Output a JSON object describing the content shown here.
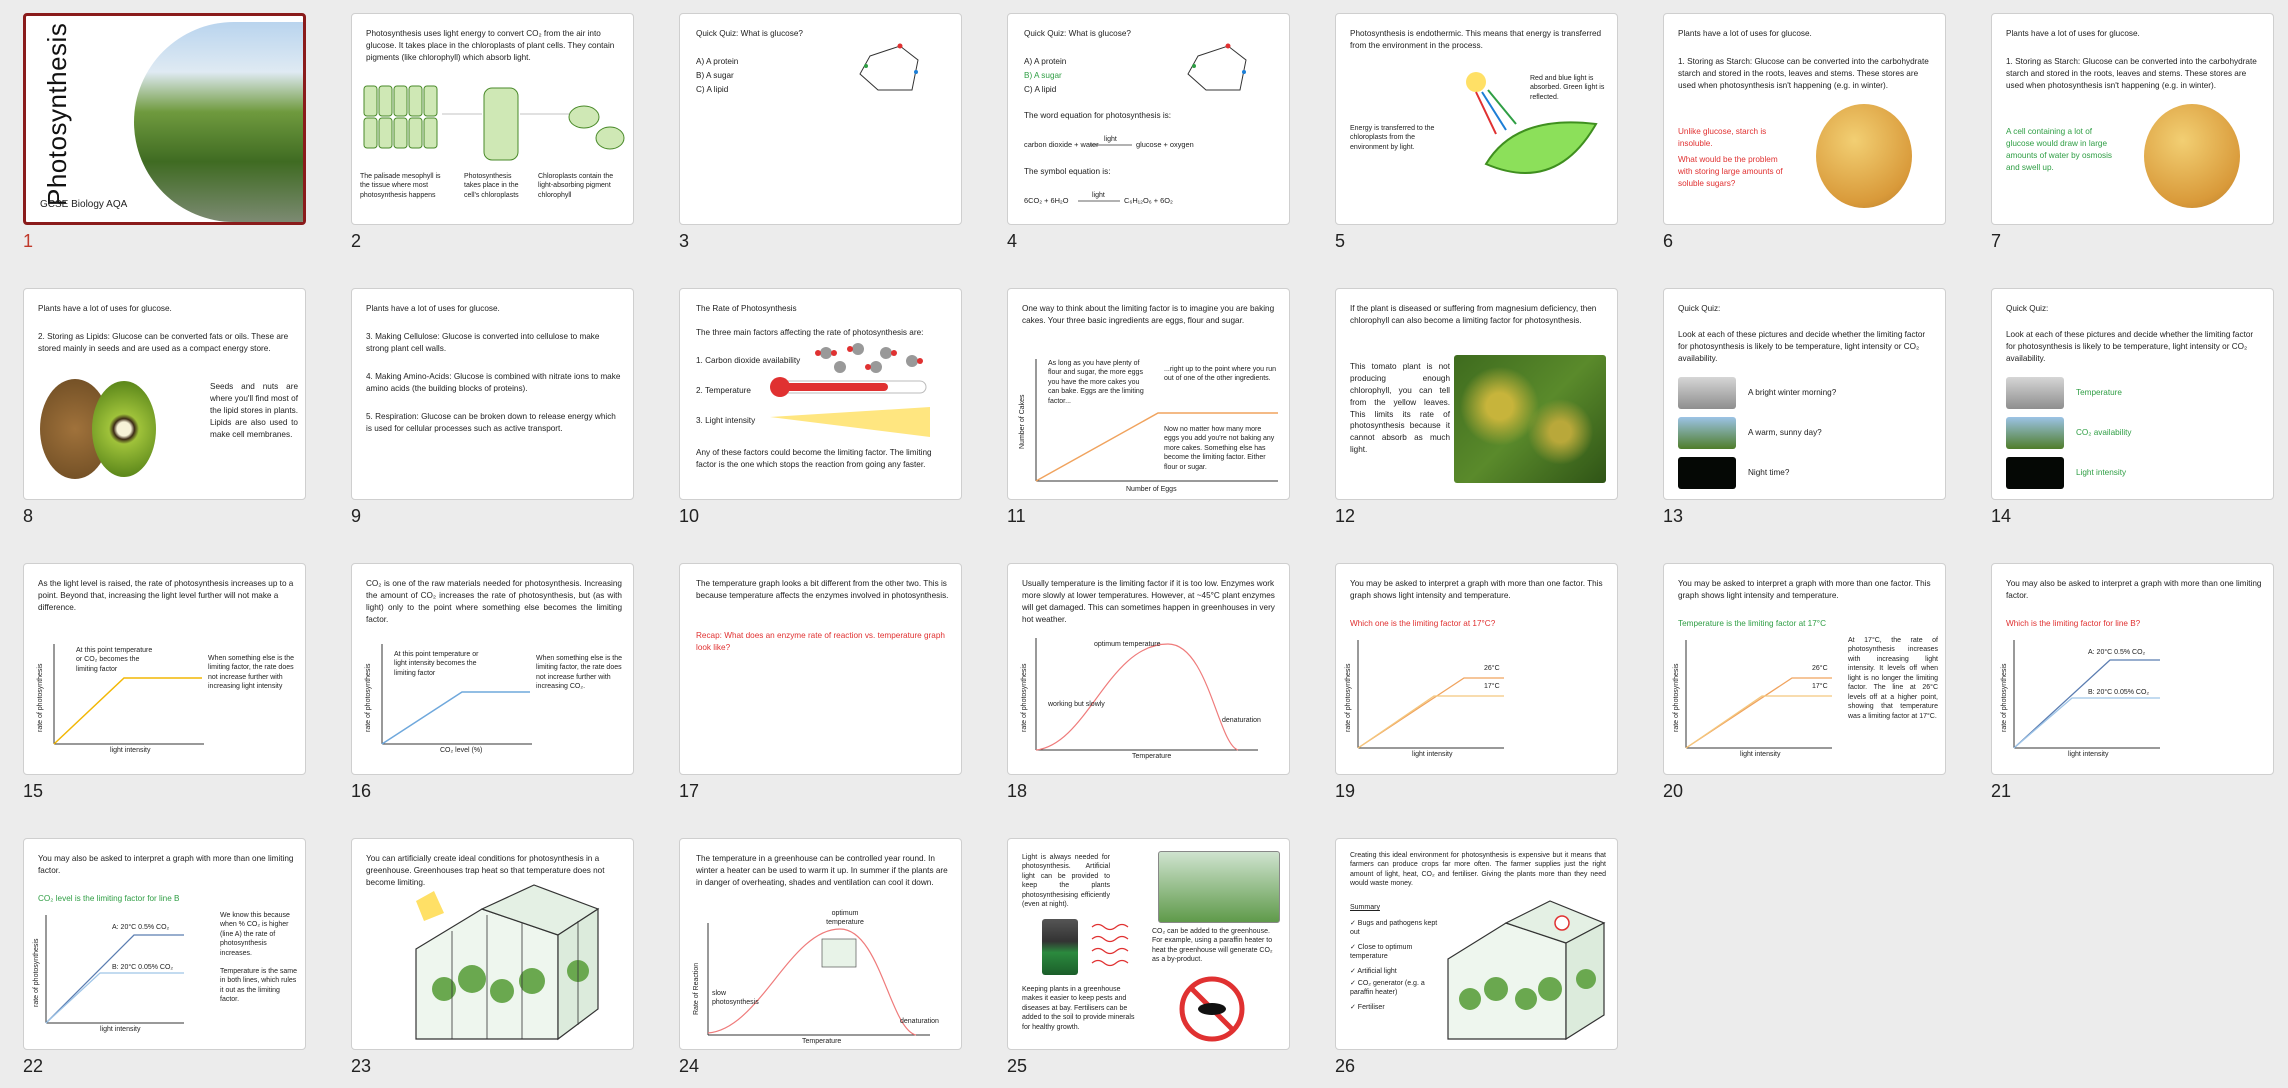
{
  "app": {
    "view": "slide-sorter"
  },
  "slides": [
    {
      "n": "1",
      "title": "Photosynthesis",
      "subtitle": "GCSE Biology AQA"
    },
    {
      "n": "2",
      "body": "Photosynthesis uses light energy to convert CO₂ from the air into glucose. It takes place in the chloroplasts of plant cells. They contain pigments (like chlorophyll) which absorb light.",
      "c1": "The palisade mesophyll is the tissue where most photosynthesis happens",
      "c2": "Photosynthesis takes place in the cell's chloroplasts",
      "c3": "Chloroplasts contain the light-absorbing pigment chlorophyll"
    },
    {
      "n": "3",
      "q": "Quick Quiz: What is glucose?",
      "a": "A) A protein",
      "b": "B) A sugar",
      "c": "C) A lipid"
    },
    {
      "n": "4",
      "q": "Quick Quiz: What is glucose?",
      "a": "A) A protein",
      "b": "B) A sugar",
      "c": "C) A lipid",
      "l1": "The word equation for photosynthesis is:",
      "eq1a": "carbon dioxide + water",
      "eq1b": "glucose + oxygen",
      "light": "light",
      "l2": "The symbol equation is:",
      "eq2a": "6CO₂ + 6H₂O",
      "eq2b": "C₆H₁₂O₆ + 6O₂"
    },
    {
      "n": "5",
      "body": "Photosynthesis is endothermic. This means that energy is transferred from the environment in the process.",
      "c1": "Red and blue light is absorbed. Green light is reflected.",
      "c2": "Energy is transferred to the chloroplasts from the environment by light."
    },
    {
      "n": "6",
      "h": "Plants have a lot of uses for glucose.",
      "p": "1. Storing as Starch: Glucose can be converted into the carbohydrate starch and stored in the roots, leaves and stems. These stores are used when photosynthesis isn't happening (e.g. in winter).",
      "r1": "Unlike glucose, starch is insoluble.",
      "r2": "What would be the problem with storing large amounts of soluble sugars?"
    },
    {
      "n": "7",
      "h": "Plants have a lot of uses for glucose.",
      "p": "1. Storing as Starch: Glucose can be converted into the carbohydrate starch and stored in the roots, leaves and stems. These stores are used when photosynthesis isn't happening (e.g. in winter).",
      "g1": "A cell containing a lot of glucose would draw in large amounts of water by osmosis and swell up."
    },
    {
      "n": "8",
      "h": "Plants have a lot of uses for glucose.",
      "p": "2. Storing as Lipids: Glucose can be converted fats or oils. These are stored mainly in seeds and are used as a compact energy store.",
      "c1": "Seeds and nuts are where you'll find most of the lipid stores in plants. Lipids are also used to make cell membranes."
    },
    {
      "n": "9",
      "h": "Plants have a lot of uses for glucose.",
      "p3": "3. Making Cellulose: Glucose is converted into cellulose to make strong plant cell walls.",
      "p4": "4. Making Amino-Acids: Glucose is combined with nitrate ions to make amino acids (the building blocks of proteins).",
      "p5": "5. Respiration: Glucose can be broken down to release energy which is used for cellular processes such as active transport."
    },
    {
      "n": "10",
      "h": "The Rate of Photosynthesis",
      "p": "The three main factors affecting the rate of photosynthesis are:",
      "f1": "1. Carbon dioxide availability",
      "f2": "2. Temperature",
      "f3": "3. Light intensity",
      "foot": "Any of these factors could become the limiting factor. The limiting factor is the one which stops the reaction from going any faster."
    },
    {
      "n": "11",
      "p": "One way to think about the limiting factor is to imagine you are baking cakes. Your three basic ingredients are eggs, flour and sugar.",
      "a1": "As long as you have plenty of flour and sugar, the more eggs you have the more cakes you can bake. Eggs are the limiting factor...",
      "a2": "...right up to the point where you run out of one of the other ingredients.",
      "a3": "Now no matter how many more eggs you add you're not baking any more cakes. Something else has become the limiting factor. Either flour or sugar.",
      "ylab": "Number of Cakes",
      "xlab": "Number of Eggs"
    },
    {
      "n": "12",
      "p": "If the plant is diseased or suffering from magnesium deficiency, then chlorophyll can also become a limiting factor for photosynthesis.",
      "c1": "This tomato plant is not producing enough chlorophyll, you can tell from the yellow leaves. This limits its rate of photosynthesis because it cannot absorb as much light."
    },
    {
      "n": "13",
      "h": "Quick Quiz:",
      "p": "Look at each of these pictures and decide whether the limiting factor for photosynthesis is likely to be temperature, light intensity or CO₂ availability.",
      "q1": "A bright winter morning?",
      "q2": "A warm, sunny day?",
      "q3": "Night time?"
    },
    {
      "n": "14",
      "h": "Quick Quiz:",
      "p": "Look at each of these pictures and decide whether the limiting factor for photosynthesis is likely to be temperature, light intensity or CO₂ availability.",
      "q1": "Temperature",
      "q2": "CO₂ availability",
      "q3": "Light intensity"
    },
    {
      "n": "15",
      "p": "As the light level is raised, the rate of photosynthesis increases up to a point. Beyond that, increasing the light level further will not make a difference.",
      "a1": "At this point temperature or CO₂ becomes the limiting factor",
      "a2": "When something else is the limiting factor, the rate does not increase further with increasing light intensity",
      "ylab": "rate of photosynthesis",
      "xlab": "light intensity"
    },
    {
      "n": "16",
      "p": "CO₂ is one of the raw materials needed for photosynthesis. Increasing the amount of CO₂ increases the rate of photosynthesis, but (as with light) only to the point where something else becomes the limiting factor.",
      "a1": "At this point temperature or light intensity becomes the limiting factor",
      "a2": "When something else is the limiting factor, the rate does not increase further with increasing CO₂.",
      "ylab": "rate of photosynthesis",
      "xlab": "CO₂ level (%)"
    },
    {
      "n": "17",
      "p": "The temperature graph looks a bit different from the other two. This is because temperature affects the enzymes involved in photosynthesis.",
      "r": "Recap: What does an enzyme rate of reaction vs. temperature graph look like?"
    },
    {
      "n": "18",
      "p": "Usually temperature is the limiting factor if it is too low. Enzymes work more slowly at lower temperatures. However, at ~45°C plant enzymes will get damaged. This can sometimes happen in greenhouses in very hot weather.",
      "a1": "optimum temperature",
      "a2": "working but slowly",
      "a3": "denaturation",
      "ylab": "rate of photosynthesis",
      "xlab": "Temperature"
    },
    {
      "n": "19",
      "p": "You may be asked to interpret a graph with more than one factor. This graph shows light intensity and temperature.",
      "r": "Which one is the limiting factor at 17°C?",
      "l1": "26°C",
      "l2": "17°C",
      "ylab": "rate of photosynthesis",
      "xlab": "light intensity"
    },
    {
      "n": "20",
      "p": "You may be asked to interpret a graph with more than one factor. This graph shows light intensity and temperature.",
      "g": "Temperature is the limiting factor at 17°C",
      "c": "At 17°C, the rate of photosynthesis increases with increasing light intensity. It levels off when light is no longer the limiting factor. The line at 26°C levels off at a higher point, showing that temperature was a limiting factor at 17°C.",
      "l1": "26°C",
      "l2": "17°C",
      "ylab": "rate of photosynthesis",
      "xlab": "light intensity"
    },
    {
      "n": "21",
      "p": "You may also be asked to interpret a graph with more than one limiting factor.",
      "r": "Which is the limiting factor for line B?",
      "la": "A: 20°C  0.5% CO₂",
      "lb": "B: 20°C  0.05% CO₂",
      "ylab": "rate of photosynthesis",
      "xlab": "light intensity"
    },
    {
      "n": "22",
      "p": "You may also be asked to interpret a graph with more than one limiting factor.",
      "g": "CO₂ level is the limiting factor for line B",
      "c1": "We know this because when % CO₂ is higher (line A) the rate of photosynthesis increases.",
      "c2": "Temperature is the same in both lines, which rules it out as the limiting factor.",
      "la": "A: 20°C  0.5% CO₂",
      "lb": "B: 20°C  0.05% CO₂",
      "ylab": "rate of photosynthesis",
      "xlab": "light intensity"
    },
    {
      "n": "23",
      "p": "You can artificially create ideal conditions for photosynthesis in a greenhouse. Greenhouses trap heat so that temperature does not become limiting."
    },
    {
      "n": "24",
      "p": "The temperature in a greenhouse can be controlled year round. In winter a heater can be used to warm it up. In summer if the plants are in danger of overheating, shades and ventilation can cool it down.",
      "a1": "optimum temperature",
      "a2": "slow photosynthesis",
      "a3": "denaturation",
      "ylab": "Rate of Reaction",
      "xlab": "Temperature"
    },
    {
      "n": "25",
      "c1": "Light is always needed for photosynthesis. Artificial light can be provided to keep the plants photosynthesising efficiently (even at night).",
      "c2": "CO₂ can be added to the greenhouse. For example, using a paraffin heater to heat the greenhouse will generate CO₂ as a by-product.",
      "c3": "Keeping plants in a greenhouse makes it easier to keep pests and diseases at bay. Fertilisers can be added to the soil to provide minerals for healthy growth."
    },
    {
      "n": "26",
      "p": "Creating this ideal environment for photosynthesis is expensive but it means that farmers can produce crops far more often. The farmer supplies just the right amount of light, heat, CO₂ and fertiliser. Giving the plants more than they need would waste money.",
      "h": "Summary",
      "s1": "✓ Bugs and pathogens kept out",
      "s2": "✓ Close to optimum temperature",
      "s3": "✓ Artificial light",
      "s4": "✓ CO₂ generator (e.g. a paraffin heater)",
      "s5": "✓ Fertiliser"
    }
  ],
  "colors": {
    "selected": "#8a1b1b",
    "selected_num": "#c0392b",
    "red": "#e03131",
    "green": "#2f9e44",
    "curve_orange": "#f0a35e",
    "curve_yellow": "#f2b705",
    "curve_blue": "#6fa8dc",
    "curve_red": "#ef7b7b"
  }
}
